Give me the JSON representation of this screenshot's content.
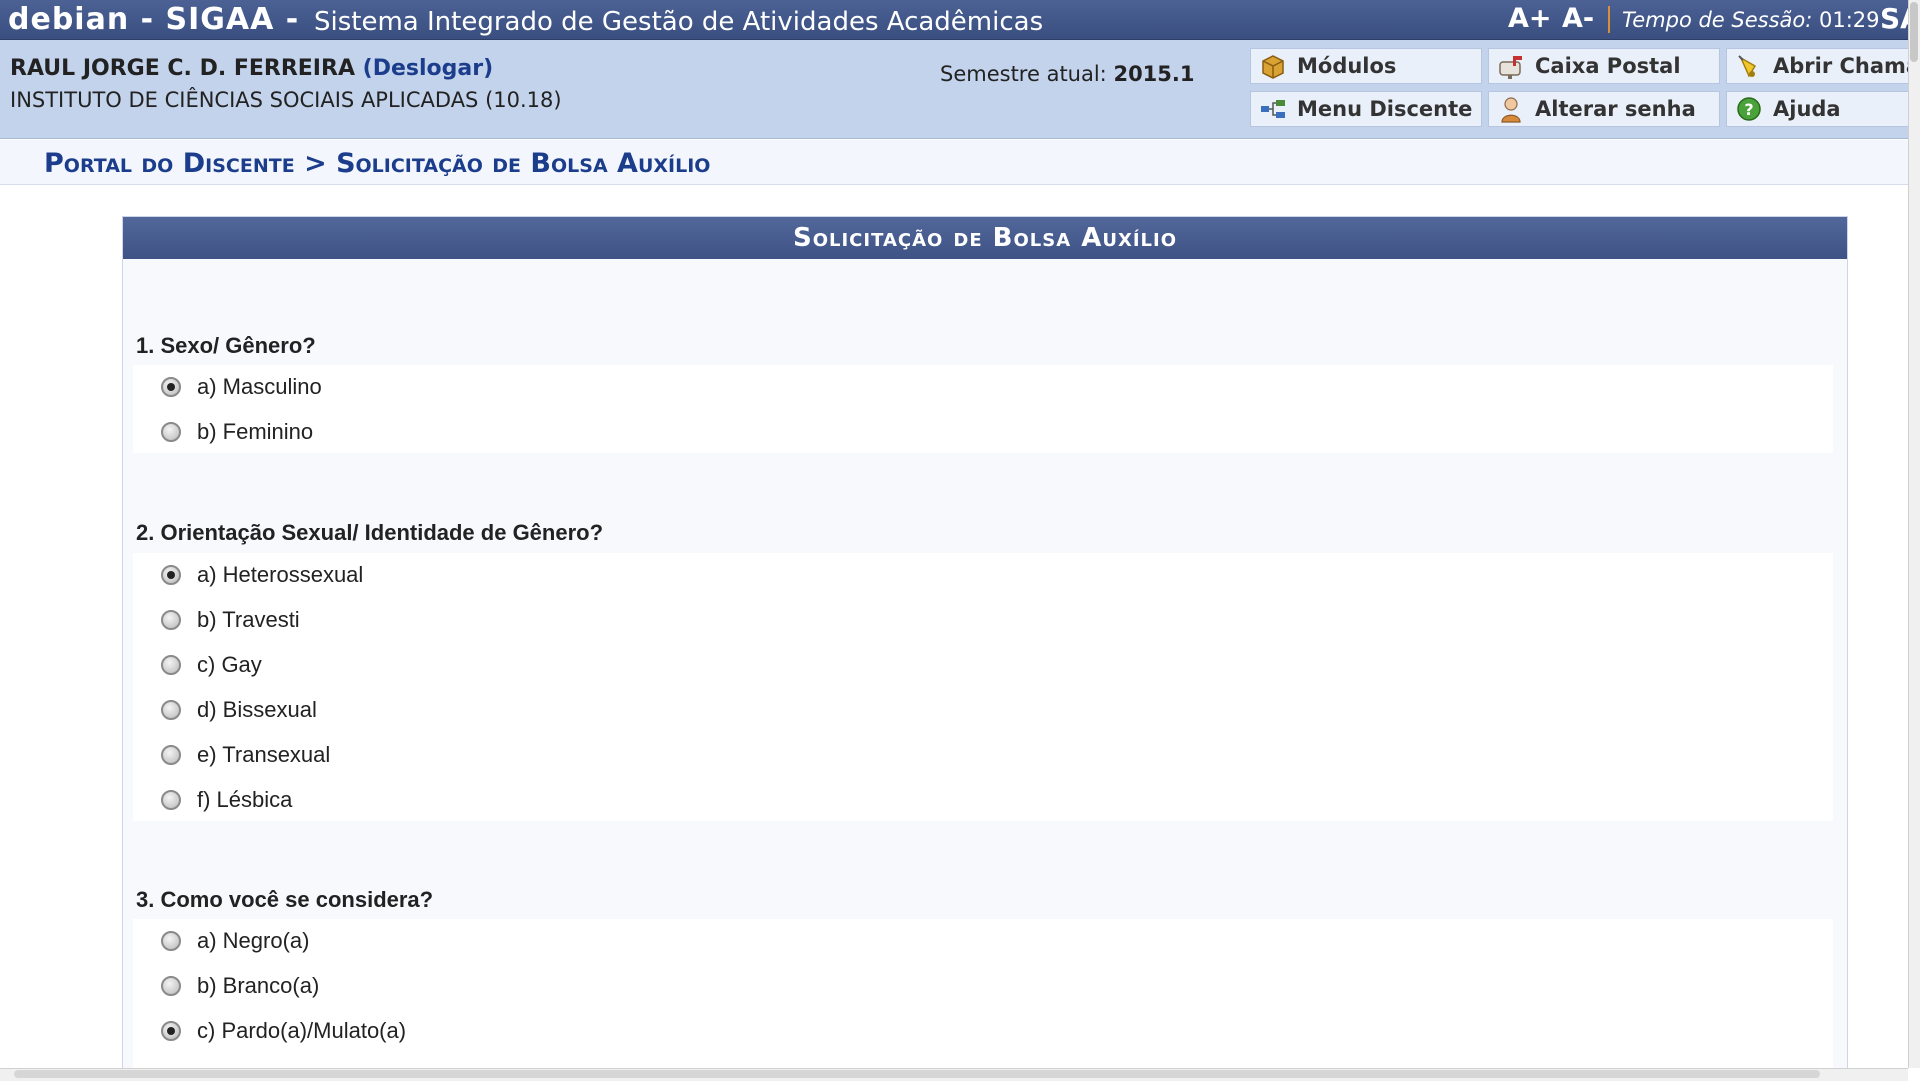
{
  "topbar": {
    "system_name": "debian - SIGAA -",
    "system_title": "Sistema Integrado de Gestão de Atividades Acadêmicas",
    "font_increase": "A+",
    "font_decrease": "A-",
    "session_label": "Tempo de Sessão:",
    "session_time": "01:29",
    "truncated_link": "SA"
  },
  "user": {
    "name": "RAUL JORGE C. D. FERREIRA",
    "logout": "(Deslogar)",
    "institute": "INSTITUTO DE CIÊNCIAS SOCIAIS APLICADAS (10.18)",
    "semester_label": "Semestre atual:",
    "semester_value": "2015.1"
  },
  "quick_links": [
    {
      "label": "Módulos",
      "icon": "modules-box-icon"
    },
    {
      "label": "Caixa Postal",
      "icon": "mailbox-icon"
    },
    {
      "label": "Abrir Chama",
      "icon": "bell-icon"
    },
    {
      "label": "Menu Discente",
      "icon": "menu-tree-icon"
    },
    {
      "label": "Alterar senha",
      "icon": "user-key-icon"
    },
    {
      "label": "Ajuda",
      "icon": "help-icon"
    }
  ],
  "breadcrumb": "Portal do Discente > Solicitação de Bolsa Auxílio",
  "form": {
    "title": "Solicitação de Bolsa Auxílio",
    "questions": [
      {
        "text": "1. Sexo/ Gênero?",
        "options": [
          "a) Masculino",
          "b) Feminino"
        ],
        "selected": 0
      },
      {
        "text": "2. Orientação Sexual/ Identidade de Gênero?",
        "options": [
          "a) Heterossexual",
          "b) Travesti",
          "c) Gay",
          "d) Bissexual",
          "e) Transexual",
          "f) Lésbica"
        ],
        "selected": 0
      },
      {
        "text": "3. Como você se considera?",
        "options": [
          "a) Negro(a)",
          "b) Branco(a)",
          "c) Pardo(a)/Mulato(a)"
        ],
        "selected": 2
      }
    ]
  },
  "colors": {
    "topbar": "#4c6194",
    "user_panel": "#c3d3ec",
    "breadcrumb_text": "#1b3d8c",
    "form_header": "#4a5f92"
  }
}
